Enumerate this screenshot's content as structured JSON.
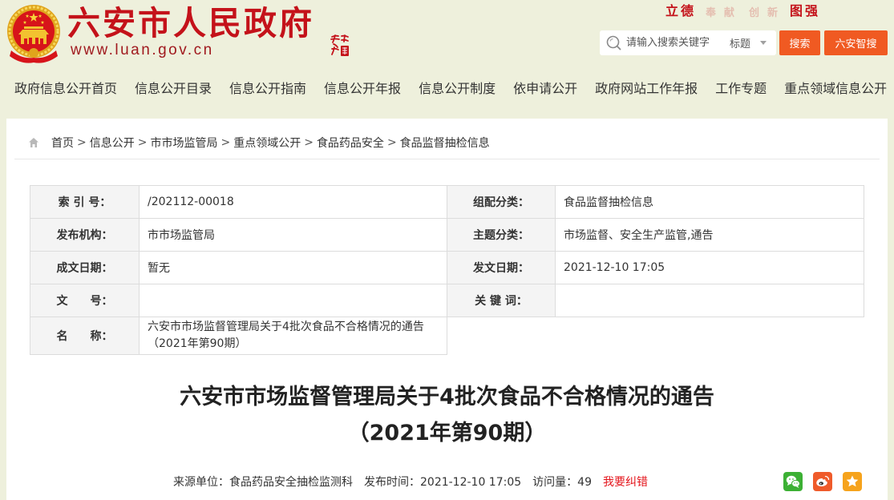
{
  "header": {
    "site_title": "六安市人民政府",
    "site_url": "www.luan.gov.cn",
    "slogan": [
      "立德",
      "奉献",
      "创新",
      "图强"
    ],
    "search": {
      "placeholder": "请输入搜索关键字",
      "scope": "标题",
      "search_button": "搜索",
      "smart_search_button": "六安智搜"
    }
  },
  "nav": {
    "items": [
      "政府信息公开首页",
      "信息公开目录",
      "信息公开指南",
      "信息公开年报",
      "信息公开制度",
      "依申请公开",
      "政府网站工作年报",
      "工作专题",
      "重点领域信息公开"
    ]
  },
  "breadcrumb": {
    "items": [
      "首页",
      "信息公开",
      "市市场监管局",
      "重点领域公开",
      "食品药品安全",
      "食品监督抽检信息"
    ],
    "separator": ">"
  },
  "info_table": {
    "rows": [
      [
        {
          "label": "索 引 号：",
          "value": "/202112-00018"
        },
        {
          "label": "组配分类：",
          "value": "食品监督抽检信息"
        }
      ],
      [
        {
          "label": "发布机构：",
          "value": "市市场监管局"
        },
        {
          "label": "主题分类：",
          "value": "市场监督、安全生产监管,通告"
        }
      ],
      [
        {
          "label": "成文日期：",
          "value": "暂无"
        },
        {
          "label": "发文日期：",
          "value": "2021-12-10 17:05"
        }
      ],
      [
        {
          "label": "文　　号：",
          "value": ""
        },
        {
          "label": "关 键 词：",
          "value": ""
        }
      ],
      [
        {
          "label": "名　　称：",
          "value": "六安市市场监督管理局关于4批次食品不合格情况的通告（2021年第90期）"
        }
      ]
    ]
  },
  "article": {
    "title_lines": [
      "六安市市场监督管理局关于4批次食品不合格情况的通告",
      "（2021年第90期）"
    ],
    "meta": {
      "source_label": "来源单位：",
      "source": "食品药品安全抽检监测科",
      "date_label": "发布时间：",
      "date": "2021-12-10 17:05",
      "views_label": "访问量：",
      "views": "49",
      "report_error": "我要纠错"
    }
  },
  "share": {
    "icons": [
      "wechat-icon",
      "weibo-icon",
      "favorite-star-icon"
    ]
  },
  "icons": {
    "emblem": "national-emblem-icon",
    "seal": "calligraphy-seal-icon",
    "search": "search-icon",
    "dropdown": "caret-down-icon",
    "home": "home-icon"
  },
  "colors": {
    "page_bg": "#eef0dc",
    "brand_red": "#c4121a",
    "url_red": "#a0191e",
    "button_orange": "#f05a22",
    "link_red": "#e4141b",
    "wechat_green": "#3cb034",
    "weibo_orange": "#ef5b2b",
    "favorite_orange": "#f6a31c"
  }
}
